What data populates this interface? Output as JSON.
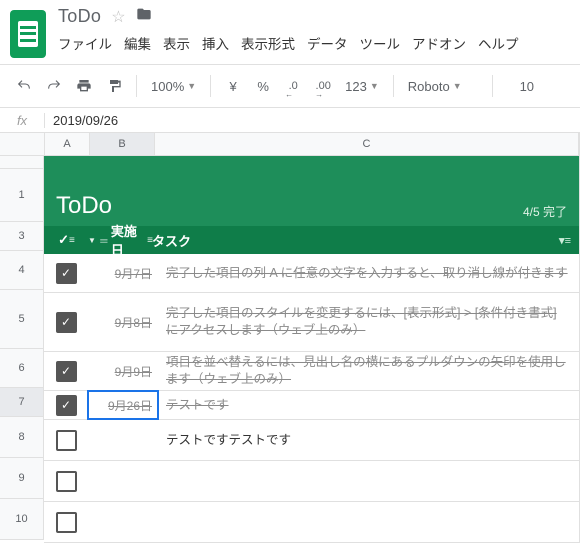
{
  "doc": {
    "title": "ToDo"
  },
  "menubar": [
    "ファイル",
    "編集",
    "表示",
    "挿入",
    "表示形式",
    "データ",
    "ツール",
    "アドオン",
    "ヘルプ"
  ],
  "toolbar": {
    "zoom": "100%",
    "currency": "¥",
    "percent": "%",
    "dec_dec": ".0",
    "inc_dec": ".00",
    "numfmt": "123",
    "font": "Roboto",
    "size": "10"
  },
  "formula_bar": {
    "label": "fx",
    "value": "2019/09/26"
  },
  "columns": {
    "A": "A",
    "B": "B",
    "C": "C"
  },
  "sheet_title": {
    "heading": "ToDo",
    "progress": "4/5 完了"
  },
  "sheet_headers": {
    "check": "✓",
    "date": "実施日",
    "task": "タスク"
  },
  "rows": [
    {
      "n": 4,
      "checked": true,
      "date": "9月7日",
      "task": "完了した項目の列 A に任意の文字を入力すると、取り消し線が付きます",
      "strike": true
    },
    {
      "n": 5,
      "checked": true,
      "date": "9月8日",
      "task": "完了した項目のスタイルを変更するには、[表示形式] > [条件付き書式] にアクセスします（ウェブ上のみ）",
      "strike": true
    },
    {
      "n": 6,
      "checked": true,
      "date": "9月9日",
      "task": "項目を並べ替えるには、見出し名の横にあるプルダウンの矢印を使用します（ウェブ上のみ）",
      "strike": true
    },
    {
      "n": 7,
      "checked": true,
      "date": "9月26日",
      "task": "テストです",
      "strike": true
    },
    {
      "n": 8,
      "checked": false,
      "date": "",
      "task": "テストですテストです",
      "strike": false
    },
    {
      "n": 9,
      "checked": false,
      "date": "",
      "task": "",
      "strike": false
    },
    {
      "n": 10,
      "checked": false,
      "date": "",
      "task": "",
      "strike": false
    }
  ]
}
